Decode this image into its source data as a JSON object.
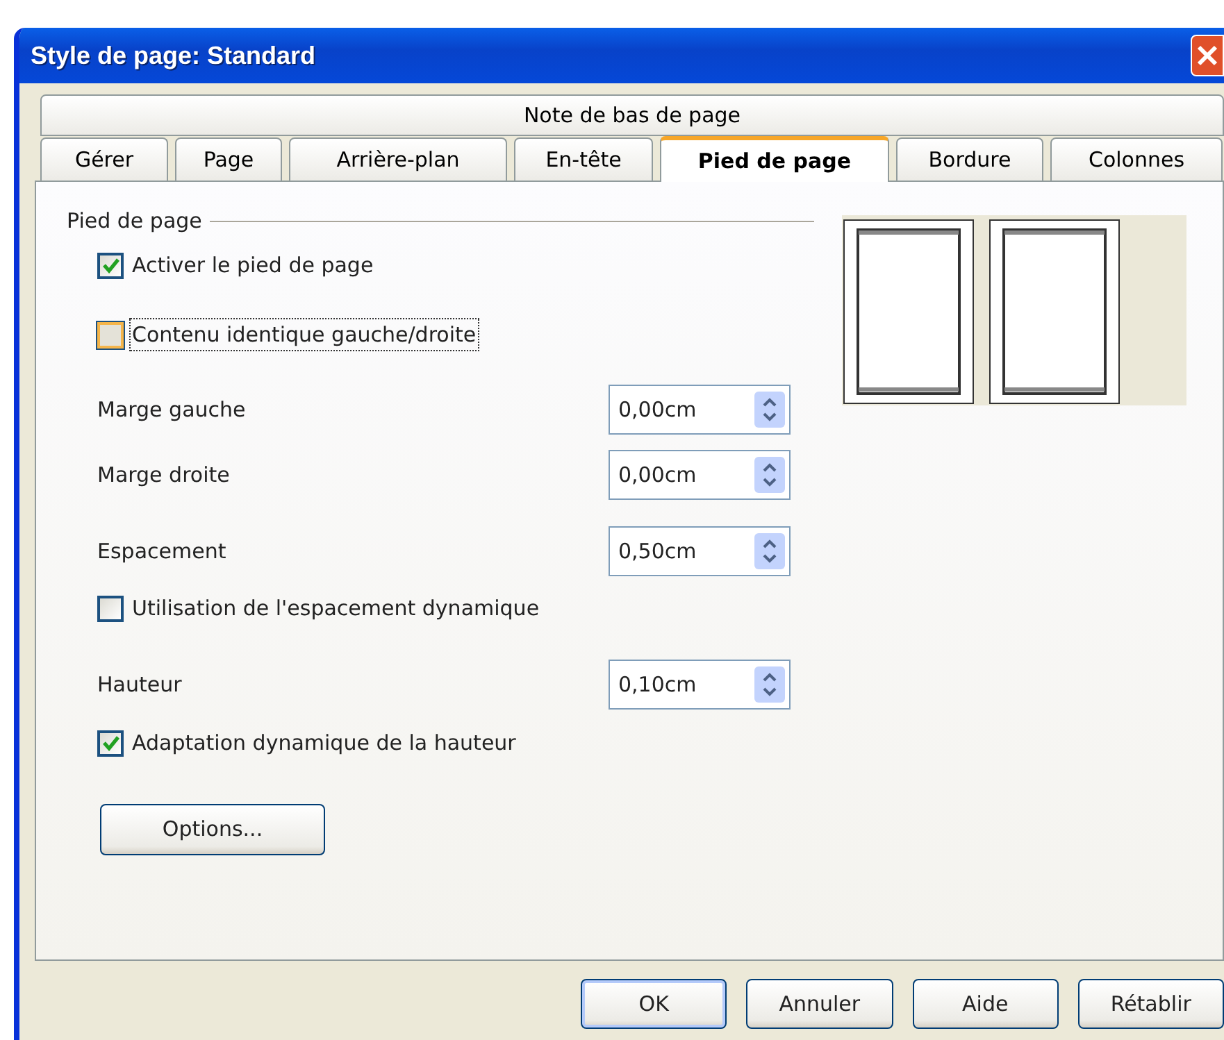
{
  "window": {
    "title": "Style de page: Standard"
  },
  "tabs_top": [
    {
      "label": "Note de bas de page",
      "selected": false
    }
  ],
  "tabs": [
    {
      "label": "Gérer",
      "selected": false
    },
    {
      "label": "Page",
      "selected": false
    },
    {
      "label": "Arrière-plan",
      "selected": false
    },
    {
      "label": "En-tête",
      "selected": false
    },
    {
      "label": "Pied de page",
      "selected": true
    },
    {
      "label": "Bordure",
      "selected": false
    },
    {
      "label": "Colonnes",
      "selected": false
    }
  ],
  "group": {
    "title": "Pied de page"
  },
  "rows": [
    {
      "kind": "checkbox",
      "label": "Activer le pied de page",
      "checked": true,
      "focused": false
    },
    {
      "kind": "checkbox",
      "label": "Contenu identique gauche/droite",
      "checked": false,
      "focused": true
    },
    {
      "kind": "spin",
      "label": "Marge gauche",
      "value": "0,00cm"
    },
    {
      "kind": "spin",
      "label": "Marge droite",
      "value": "0,00cm"
    },
    {
      "kind": "spin",
      "label": "Espacement",
      "value": "0,50cm"
    },
    {
      "kind": "checkbox",
      "label": "Utilisation de l'espacement dynamique",
      "checked": false,
      "focused": false
    },
    {
      "kind": "spin",
      "label": "Hauteur",
      "value": "0,10cm"
    },
    {
      "kind": "checkbox",
      "label": "Adaptation dynamique de la hauteur",
      "checked": true,
      "focused": false
    },
    {
      "kind": "button",
      "label": "Options..."
    }
  ],
  "buttons": [
    "OK",
    "Annuler",
    "Aide",
    "Rétablir"
  ]
}
